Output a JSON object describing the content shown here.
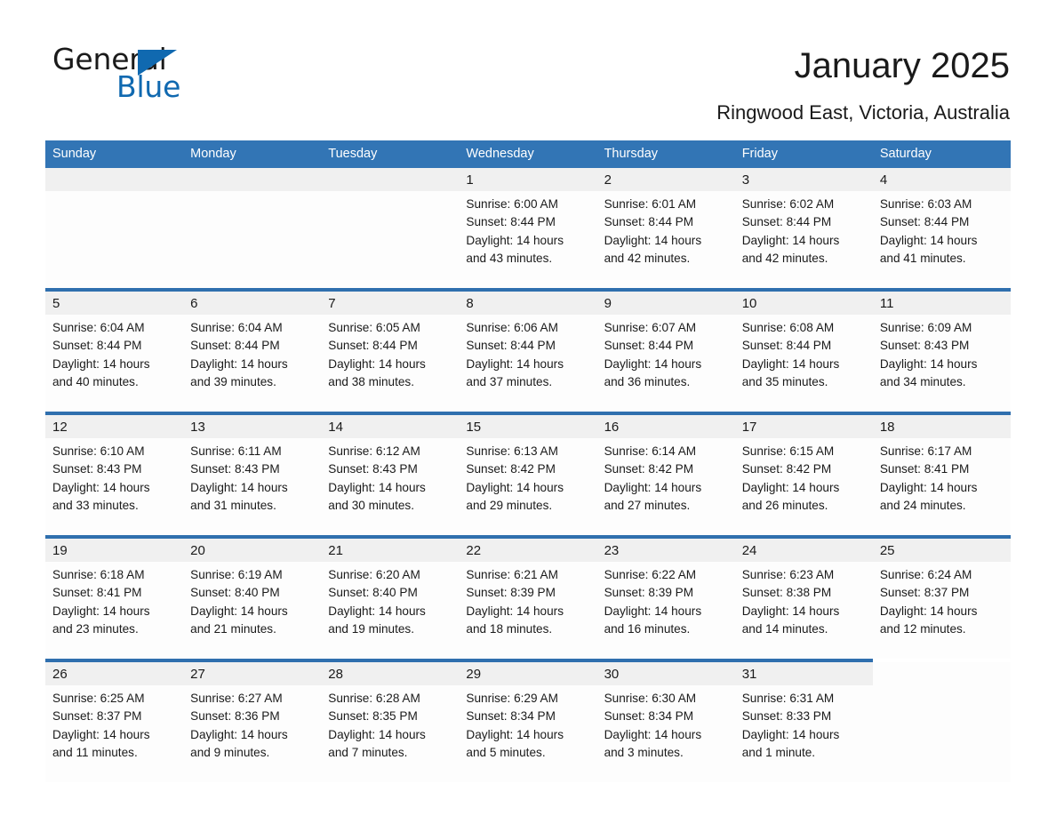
{
  "brand": {
    "logo_word_1": "General",
    "logo_word_2": "Blue",
    "triangle_icon": "triangle-icon",
    "accent_color": "#1069b0"
  },
  "header": {
    "title": "January 2025",
    "subtitle": "Ringwood East, Victoria, Australia"
  },
  "calendar": {
    "header_bg_color": "#3275b5",
    "daynum_band_color": "#f0f0f0",
    "week_separator_color": "#2f6fae",
    "weekday_headers": [
      "Sunday",
      "Monday",
      "Tuesday",
      "Wednesday",
      "Thursday",
      "Friday",
      "Saturday"
    ],
    "weeks": [
      [
        {
          "day": "",
          "lines": []
        },
        {
          "day": "",
          "lines": []
        },
        {
          "day": "",
          "lines": []
        },
        {
          "day": "1",
          "lines": [
            "Sunrise: 6:00 AM",
            "Sunset: 8:44 PM",
            "Daylight: 14 hours",
            "and 43 minutes."
          ]
        },
        {
          "day": "2",
          "lines": [
            "Sunrise: 6:01 AM",
            "Sunset: 8:44 PM",
            "Daylight: 14 hours",
            "and 42 minutes."
          ]
        },
        {
          "day": "3",
          "lines": [
            "Sunrise: 6:02 AM",
            "Sunset: 8:44 PM",
            "Daylight: 14 hours",
            "and 42 minutes."
          ]
        },
        {
          "day": "4",
          "lines": [
            "Sunrise: 6:03 AM",
            "Sunset: 8:44 PM",
            "Daylight: 14 hours",
            "and 41 minutes."
          ]
        }
      ],
      [
        {
          "day": "5",
          "lines": [
            "Sunrise: 6:04 AM",
            "Sunset: 8:44 PM",
            "Daylight: 14 hours",
            "and 40 minutes."
          ]
        },
        {
          "day": "6",
          "lines": [
            "Sunrise: 6:04 AM",
            "Sunset: 8:44 PM",
            "Daylight: 14 hours",
            "and 39 minutes."
          ]
        },
        {
          "day": "7",
          "lines": [
            "Sunrise: 6:05 AM",
            "Sunset: 8:44 PM",
            "Daylight: 14 hours",
            "and 38 minutes."
          ]
        },
        {
          "day": "8",
          "lines": [
            "Sunrise: 6:06 AM",
            "Sunset: 8:44 PM",
            "Daylight: 14 hours",
            "and 37 minutes."
          ]
        },
        {
          "day": "9",
          "lines": [
            "Sunrise: 6:07 AM",
            "Sunset: 8:44 PM",
            "Daylight: 14 hours",
            "and 36 minutes."
          ]
        },
        {
          "day": "10",
          "lines": [
            "Sunrise: 6:08 AM",
            "Sunset: 8:44 PM",
            "Daylight: 14 hours",
            "and 35 minutes."
          ]
        },
        {
          "day": "11",
          "lines": [
            "Sunrise: 6:09 AM",
            "Sunset: 8:43 PM",
            "Daylight: 14 hours",
            "and 34 minutes."
          ]
        }
      ],
      [
        {
          "day": "12",
          "lines": [
            "Sunrise: 6:10 AM",
            "Sunset: 8:43 PM",
            "Daylight: 14 hours",
            "and 33 minutes."
          ]
        },
        {
          "day": "13",
          "lines": [
            "Sunrise: 6:11 AM",
            "Sunset: 8:43 PM",
            "Daylight: 14 hours",
            "and 31 minutes."
          ]
        },
        {
          "day": "14",
          "lines": [
            "Sunrise: 6:12 AM",
            "Sunset: 8:43 PM",
            "Daylight: 14 hours",
            "and 30 minutes."
          ]
        },
        {
          "day": "15",
          "lines": [
            "Sunrise: 6:13 AM",
            "Sunset: 8:42 PM",
            "Daylight: 14 hours",
            "and 29 minutes."
          ]
        },
        {
          "day": "16",
          "lines": [
            "Sunrise: 6:14 AM",
            "Sunset: 8:42 PM",
            "Daylight: 14 hours",
            "and 27 minutes."
          ]
        },
        {
          "day": "17",
          "lines": [
            "Sunrise: 6:15 AM",
            "Sunset: 8:42 PM",
            "Daylight: 14 hours",
            "and 26 minutes."
          ]
        },
        {
          "day": "18",
          "lines": [
            "Sunrise: 6:17 AM",
            "Sunset: 8:41 PM",
            "Daylight: 14 hours",
            "and 24 minutes."
          ]
        }
      ],
      [
        {
          "day": "19",
          "lines": [
            "Sunrise: 6:18 AM",
            "Sunset: 8:41 PM",
            "Daylight: 14 hours",
            "and 23 minutes."
          ]
        },
        {
          "day": "20",
          "lines": [
            "Sunrise: 6:19 AM",
            "Sunset: 8:40 PM",
            "Daylight: 14 hours",
            "and 21 minutes."
          ]
        },
        {
          "day": "21",
          "lines": [
            "Sunrise: 6:20 AM",
            "Sunset: 8:40 PM",
            "Daylight: 14 hours",
            "and 19 minutes."
          ]
        },
        {
          "day": "22",
          "lines": [
            "Sunrise: 6:21 AM",
            "Sunset: 8:39 PM",
            "Daylight: 14 hours",
            "and 18 minutes."
          ]
        },
        {
          "day": "23",
          "lines": [
            "Sunrise: 6:22 AM",
            "Sunset: 8:39 PM",
            "Daylight: 14 hours",
            "and 16 minutes."
          ]
        },
        {
          "day": "24",
          "lines": [
            "Sunrise: 6:23 AM",
            "Sunset: 8:38 PM",
            "Daylight: 14 hours",
            "and 14 minutes."
          ]
        },
        {
          "day": "25",
          "lines": [
            "Sunrise: 6:24 AM",
            "Sunset: 8:37 PM",
            "Daylight: 14 hours",
            "and 12 minutes."
          ]
        }
      ],
      [
        {
          "day": "26",
          "lines": [
            "Sunrise: 6:25 AM",
            "Sunset: 8:37 PM",
            "Daylight: 14 hours",
            "and 11 minutes."
          ]
        },
        {
          "day": "27",
          "lines": [
            "Sunrise: 6:27 AM",
            "Sunset: 8:36 PM",
            "Daylight: 14 hours",
            "and 9 minutes."
          ]
        },
        {
          "day": "28",
          "lines": [
            "Sunrise: 6:28 AM",
            "Sunset: 8:35 PM",
            "Daylight: 14 hours",
            "and 7 minutes."
          ]
        },
        {
          "day": "29",
          "lines": [
            "Sunrise: 6:29 AM",
            "Sunset: 8:34 PM",
            "Daylight: 14 hours",
            "and 5 minutes."
          ]
        },
        {
          "day": "30",
          "lines": [
            "Sunrise: 6:30 AM",
            "Sunset: 8:34 PM",
            "Daylight: 14 hours",
            "and 3 minutes."
          ]
        },
        {
          "day": "31",
          "lines": [
            "Sunrise: 6:31 AM",
            "Sunset: 8:33 PM",
            "Daylight: 14 hours",
            "and 1 minute."
          ]
        },
        {
          "day": "",
          "lines": []
        }
      ]
    ]
  }
}
